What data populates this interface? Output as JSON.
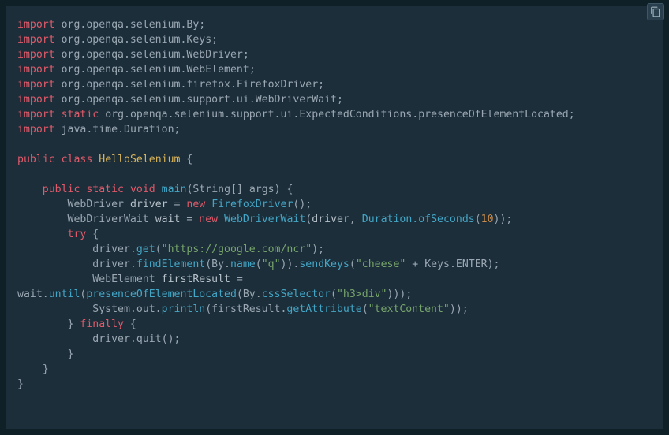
{
  "copy_tooltip": "Copy",
  "code": {
    "imports": [
      {
        "pkg": "org.openqa.selenium",
        "cls": "By"
      },
      {
        "pkg": "org.openqa.selenium",
        "cls": "Keys"
      },
      {
        "pkg": "org.openqa.selenium",
        "cls": "WebDriver"
      },
      {
        "pkg": "org.openqa.selenium",
        "cls": "WebElement"
      },
      {
        "pkg": "org.openqa.selenium.firefox",
        "cls": "FirefoxDriver"
      },
      {
        "pkg": "org.openqa.selenium.support.ui",
        "cls": "WebDriverWait"
      }
    ],
    "import_static": {
      "pkg": "org.openqa.selenium.support.ui.ExpectedConditions",
      "member": "presenceOfElementLocated"
    },
    "import_extra": {
      "pkg": "java.time",
      "cls": "Duration"
    },
    "class_name": "HelloSelenium",
    "main_sig": {
      "ret": "void",
      "name": "main",
      "params": "String[] args"
    },
    "body": {
      "l1_driver_type": "WebDriver",
      "l1_driver_var": "driver",
      "l1_driver_new": "FirefoxDriver",
      "l2_wait_type": "WebDriverWait",
      "l2_wait_var": "wait",
      "l2_wait_new": "WebDriverWait",
      "l2_wait_arg1": "driver",
      "l2_wait_dur_call": "Duration.ofSeconds",
      "l2_wait_dur_val": "10",
      "l3_get_url": "\"https://google.com/ncr\"",
      "l4_byname_arg": "\"q\"",
      "l4_sendkeys_arg1": "\"cheese\"",
      "l4_sendkeys_arg2": "Keys.ENTER",
      "l5_type": "WebElement",
      "l5_var": "firstResult",
      "l6_selector": "\"h3>div\"",
      "l7_attr": "\"textContent\"",
      "l8_quit": "driver.quit"
    },
    "kw": {
      "import": "import",
      "static": "static",
      "public": "public",
      "class": "class",
      "void": "void",
      "new": "new",
      "try": "try",
      "finally": "finally"
    }
  }
}
